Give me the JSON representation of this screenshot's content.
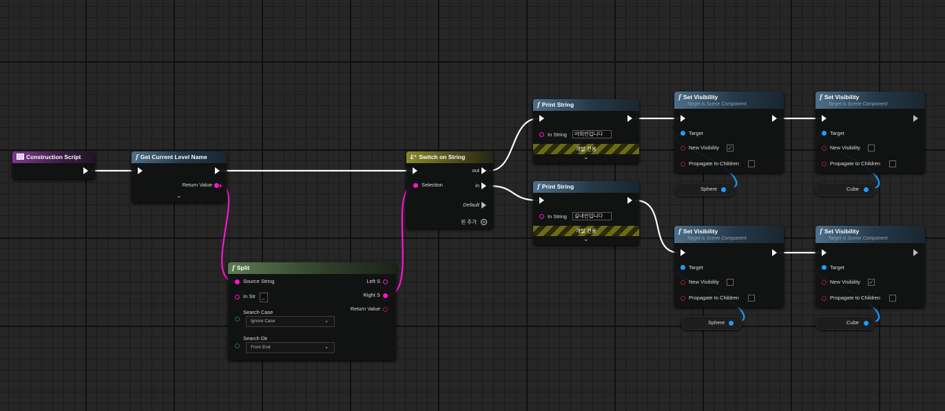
{
  "colors": {
    "exec_wire": "#ffffff",
    "string_wire": "#ff14d0",
    "object_wire": "#1a9fff",
    "bool_pin": "#a52020",
    "function_header": "#4d6f8a",
    "event_header": "#7b3a8c",
    "pure_header": "#5f7a52",
    "switch_header": "#8a8a2a"
  },
  "nodes": {
    "construction": {
      "title": "Construction Script"
    },
    "get_level": {
      "title": "Get Current Level Name",
      "fn": "f",
      "return_value": "Return Value"
    },
    "split": {
      "title": "Split",
      "fn": "f",
      "source_string": "Source String",
      "in_str": "In Str",
      "in_str_value": "_",
      "left_s": "Left S",
      "right_s": "Right S",
      "return_value": "Return Value",
      "search_case_label": "Search Case",
      "search_case_value": "Ignore Case",
      "search_dir_label": "Search Dir",
      "search_dir_value": "From End"
    },
    "switch": {
      "title": "Switch on String",
      "selection": "Selection",
      "out": "out",
      "in": "in",
      "default": "Default",
      "add_pin": "핀 추가"
    },
    "print1": {
      "title": "Print String",
      "fn": "f",
      "in_string": "In String",
      "value": "야외씬입니다",
      "dev_only": "개발 전용"
    },
    "print2": {
      "title": "Print String",
      "fn": "f",
      "in_string": "In String",
      "value": "실내씬입니다",
      "dev_only": "개발 전용"
    },
    "setvis1": {
      "title": "Set Visibility",
      "fn": "f",
      "subtitle": "Target is Scene Component",
      "target": "Target",
      "new_visibility": "New Visibility",
      "new_visibility_checked": true,
      "propagate": "Propagate to Children"
    },
    "setvis2": {
      "title": "Set Visibility",
      "fn": "f",
      "subtitle": "Target is Scene Component",
      "target": "Target",
      "new_visibility": "New Visibility",
      "new_visibility_checked": false,
      "propagate": "Propagate to Children"
    },
    "setvis3": {
      "title": "Set Visibility",
      "fn": "f",
      "subtitle": "Target is Scene Component",
      "target": "Target",
      "new_visibility": "New Visibility",
      "new_visibility_checked": false,
      "propagate": "Propagate to Children"
    },
    "setvis4": {
      "title": "Set Visibility",
      "fn": "f",
      "subtitle": "Target is Scene Component",
      "target": "Target",
      "new_visibility": "New Visibility",
      "new_visibility_checked": true,
      "propagate": "Propagate to Children"
    }
  },
  "variables": {
    "sphere1": "Sphere",
    "cube1": "Cube",
    "sphere2": "Sphere",
    "cube2": "Cube"
  },
  "icons": {
    "expand": "chevron-down-icon",
    "add": "plus-circle-icon",
    "function": "function-icon",
    "event": "event-icon",
    "switch": "switch-icon"
  }
}
